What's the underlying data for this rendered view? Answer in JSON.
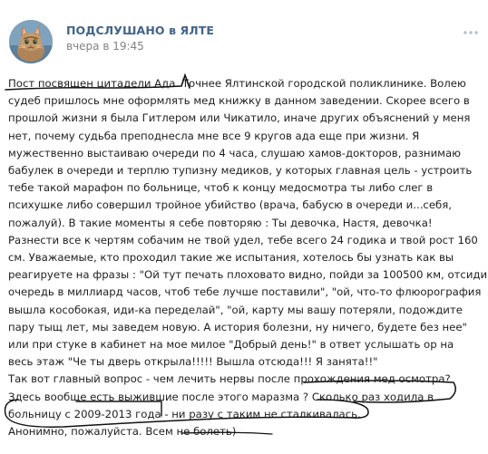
{
  "post": {
    "author": "ПОДСЛУШАНО в ЯЛТЕ",
    "date": "вчера в 19:45",
    "menu_icon": "more-dots-icon",
    "avatar_icon": "cat-avatar-icon",
    "text_lines": [
      "Пост посвящен цитадели Ада. Точнее Ялтинской городской поликлинике. Волею",
      "судеб пришлось мне оформлять мед книжку в данном заведении. Скорее всего в",
      "прошлой жизни я была Гитлером или Чикатило, иначе других объяснений у меня",
      "нет, почему судьба преподнесла мне все 9 кругов ада еще при жизни. Я",
      "мужественно выстаиваю очереди по 4 часа, слушаю хамов-докторов, разнимаю",
      "бабулек в очереди и терплю тупизну медиков, у которых главная цель - устроить",
      "тебе такой марафон по больнице, чтоб к концу медосмотра ты либо слег в",
      "психушке либо совершил тройное убийство (врача, бабусю в очереди и...себя,",
      "пожалуй). В такие моменты я себе повторяю : Ты девочка, Настя, девочка!",
      "Разнести все к чертям собачим не твой удел, тебе всего 24 годика и твой рост 160",
      "см. Уважаемые, кто проходил такие же испытания, хотелось бы узнать как вы",
      "реагируете на фразы : \"Ой тут печать плоховато видно, пойди за 100500 км, отсиди",
      "очередь в миллиард часов, чтоб тебе лучше поставили\", \"ой, что-то флюорография",
      "вышла кособокая, иди-ка переделай\", \"ой, карту мы вашу потеряли, подождите",
      "пару тыщ лет, мы заведем новую. А история болезни, ну ничего, будете без нее\"",
      "или при стуке в кабинет на мое милое \"Добрый день!\" в ответ услышать ор на",
      "весь этаж \"Че ты дверь открыла!!!!! Вышла отсюда!!! Я занята!!\"",
      "Так вот главный вопрос - чем лечить нервы после прохождения мед осмотра?",
      "Здесь вообще есть выжившие после этого маразма ? Сколько раз ходила в",
      "больницу с 2009-2013 года - ни разу с таким не сталкивалась.",
      "Анонимно, пожалуйста. Всем не болеть)"
    ]
  },
  "colors": {
    "author_link": "#42648b",
    "date_gray": "#828282",
    "text": "#1e1e1e",
    "scribble_ink": "#111111"
  }
}
